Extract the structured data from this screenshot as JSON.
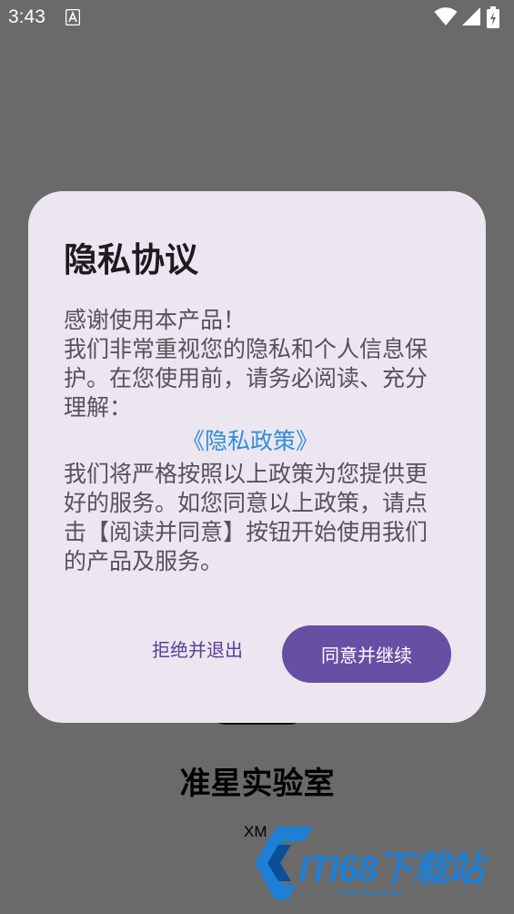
{
  "status_bar": {
    "time": "3:43",
    "notification_icon": "a-badge-icon",
    "wifi_icon": "wifi-icon",
    "signal_icon": "signal-icon",
    "battery_icon": "battery-icon"
  },
  "background": {
    "app_name": "准星实验室",
    "app_sub": "XM",
    "watermark_text": "ITI68下载站",
    "watermark_small": "ITI68 Download"
  },
  "dialog": {
    "title": "隐私协议",
    "intro_lines": [
      "感谢使用本产品！",
      "我们非常重视您的隐私和个人信息保护。在您使用前，请务必阅读、充分理解："
    ],
    "policy_link": "《隐私政策》",
    "outro": "我们将严格按照以上政策为您提供更好的服务。如您同意以上政策，请点击【阅读并同意】按钮开始使用我们的产品及服务。",
    "decline_label": "拒绝并退出",
    "agree_label": "同意并继续"
  },
  "colors": {
    "scrim": "#6a6a6a",
    "dialog_bg": "#ece6f0",
    "primary": "#6750a4",
    "link": "#2e8fd6"
  }
}
